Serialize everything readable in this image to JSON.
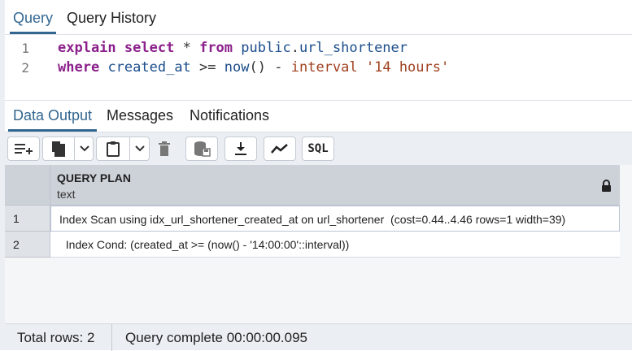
{
  "top_tabs": {
    "query": "Query",
    "query_history": "Query History"
  },
  "editor": {
    "line_numbers": [
      "1",
      "2"
    ],
    "line1": {
      "kw1": "explain",
      "kw2": "select",
      "star": "*",
      "kw3": "from",
      "schema": "public",
      "dot": ".",
      "table": "url_shortener"
    },
    "line2": {
      "kw1": "where",
      "col": "created_at",
      "op": ">=",
      "fn": "now",
      "parens": "()",
      "minus": "-",
      "kw2": "interval",
      "str": "'14 hours'"
    }
  },
  "output_tabs": {
    "data_output": "Data Output",
    "messages": "Messages",
    "notifications": "Notifications"
  },
  "toolbar": {
    "sql_label": "SQL"
  },
  "grid": {
    "column": {
      "name": "QUERY PLAN",
      "type": "text"
    },
    "rows": [
      {
        "num": "1",
        "value": "Index Scan using idx_url_shortener_created_at on url_shortener  (cost=0.44..4.46 rows=1 width=39)"
      },
      {
        "num": "2",
        "value": "  Index Cond: (created_at >= (now() - '14:00:00'::interval))"
      }
    ]
  },
  "status": {
    "total_rows": "Total rows: 2",
    "query_complete": "Query complete 00:00:00.095"
  },
  "colors": {
    "accent": "#326690",
    "keyword": "#8b1f8b",
    "identifier": "#1b4d8c",
    "string": "#a0401f"
  }
}
